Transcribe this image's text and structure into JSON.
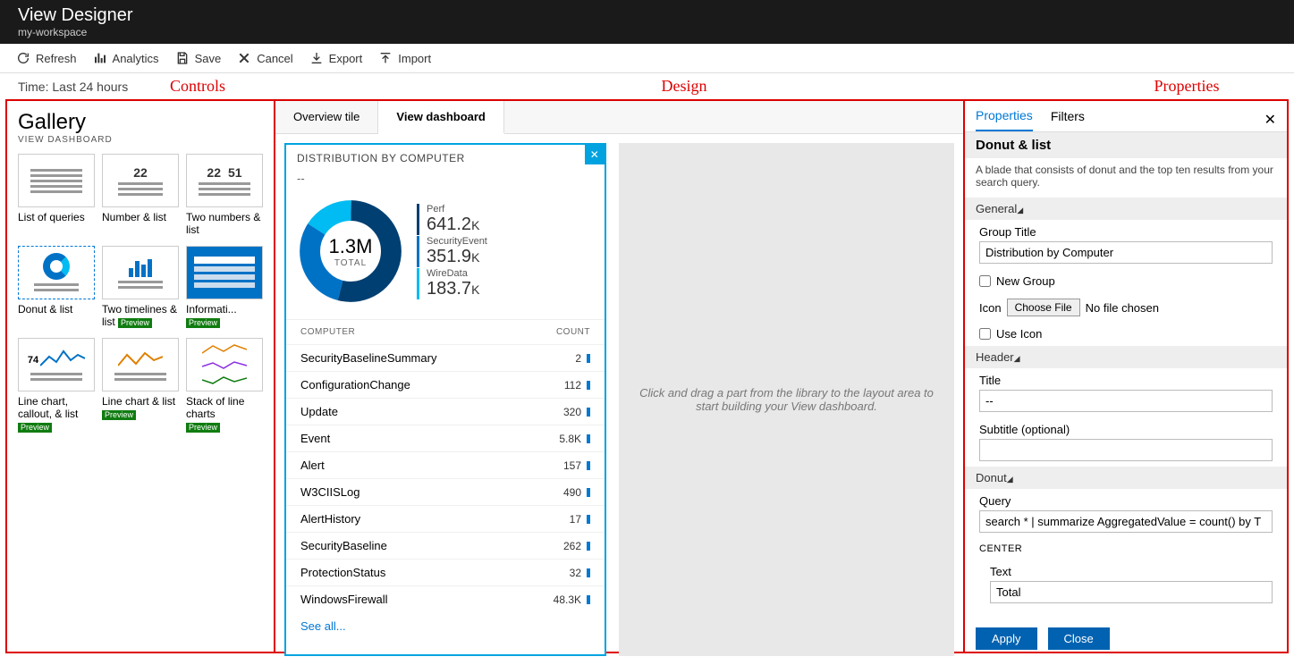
{
  "header": {
    "title": "View Designer",
    "subtitle": "my-workspace"
  },
  "toolbar": {
    "refresh": "Refresh",
    "analytics": "Analytics",
    "save": "Save",
    "cancel": "Cancel",
    "export": "Export",
    "import": "Import"
  },
  "time_label": "Time: Last 24 hours",
  "annotations": {
    "controls": "Controls",
    "design": "Design",
    "properties": "Properties"
  },
  "gallery": {
    "title": "Gallery",
    "sub": "VIEW DASHBOARD",
    "items": [
      {
        "label": "List of queries",
        "preview": false
      },
      {
        "label": "Number & list",
        "preview": false,
        "num1": "22"
      },
      {
        "label": "Two numbers & list",
        "preview": false,
        "num1": "22",
        "num2": "51"
      },
      {
        "label": "Donut & list",
        "preview": false,
        "selected": true
      },
      {
        "label": "Two timelines & list",
        "preview": true
      },
      {
        "label": "Informati...",
        "preview": true
      },
      {
        "label": "Line chart, callout, & list",
        "preview": true,
        "callout": "74"
      },
      {
        "label": "Line chart & list",
        "preview": true
      },
      {
        "label": "Stack of line charts",
        "preview": true
      }
    ]
  },
  "design": {
    "tabs": {
      "overview": "Overview tile",
      "dashboard": "View dashboard"
    },
    "tile": {
      "title": "DISTRIBUTION BY COMPUTER",
      "subtitle": "--",
      "total_value": "1.3M",
      "total_label": "TOTAL",
      "legend": [
        {
          "name": "Perf",
          "value": "641.2",
          "unit": "K",
          "color": "#003f72"
        },
        {
          "name": "SecurityEvent",
          "value": "351.9",
          "unit": "K",
          "color": "#0072c6"
        },
        {
          "name": "WireData",
          "value": "183.7",
          "unit": "K",
          "color": "#00bcf2"
        }
      ],
      "table": {
        "col1": "COMPUTER",
        "col2": "COUNT",
        "rows": [
          {
            "name": "SecurityBaselineSummary",
            "count": "2"
          },
          {
            "name": "ConfigurationChange",
            "count": "112"
          },
          {
            "name": "Update",
            "count": "320"
          },
          {
            "name": "Event",
            "count": "5.8K"
          },
          {
            "name": "Alert",
            "count": "157"
          },
          {
            "name": "W3CIISLog",
            "count": "490"
          },
          {
            "name": "AlertHistory",
            "count": "17"
          },
          {
            "name": "SecurityBaseline",
            "count": "262"
          },
          {
            "name": "ProtectionStatus",
            "count": "32"
          },
          {
            "name": "WindowsFirewall",
            "count": "48.3K"
          }
        ],
        "see_all": "See all..."
      }
    },
    "dropzone": "Click and drag a part from the library to the layout area to start building your View dashboard."
  },
  "properties": {
    "tabs": {
      "properties": "Properties",
      "filters": "Filters"
    },
    "blade_title": "Donut & list",
    "blade_desc": "A blade that consists of donut and the top ten results from your search query.",
    "general": {
      "section": "General",
      "group_title_label": "Group Title",
      "group_title_value": "Distribution by Computer",
      "new_group": "New Group",
      "icon_label": "Icon",
      "choose_file": "Choose File",
      "no_file": "No file chosen",
      "use_icon": "Use Icon"
    },
    "header": {
      "section": "Header",
      "title_label": "Title",
      "title_value": "--",
      "subtitle_label": "Subtitle (optional)",
      "subtitle_value": ""
    },
    "donut": {
      "section": "Donut",
      "query_label": "Query",
      "query_value": "search * | summarize AggregatedValue = count() by T",
      "center_section": "CENTER",
      "text_label": "Text",
      "text_value": "Total"
    },
    "actions": {
      "apply": "Apply",
      "close": "Close"
    }
  },
  "chart_data": {
    "type": "pie",
    "title": "Distribution by Computer",
    "total": 1300000,
    "series": [
      {
        "name": "Perf",
        "value": 641200
      },
      {
        "name": "SecurityEvent",
        "value": 351900
      },
      {
        "name": "WireData",
        "value": 183700
      }
    ]
  }
}
